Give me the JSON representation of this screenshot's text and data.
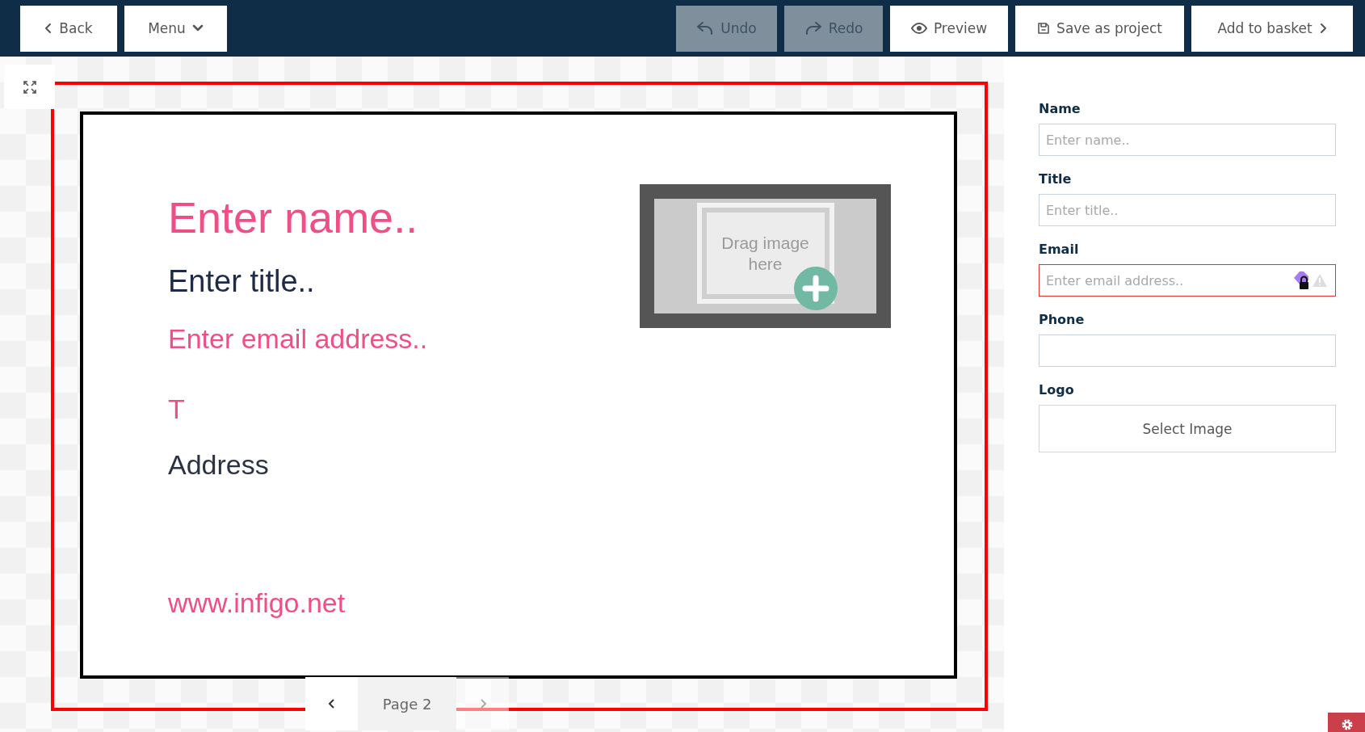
{
  "toolbar": {
    "left": [
      {
        "kind": "back",
        "label": "Back",
        "disabled": false
      },
      {
        "kind": "menu",
        "label": "Menu",
        "disabled": false
      }
    ],
    "right": [
      {
        "kind": "undo",
        "label": "Undo",
        "disabled": true
      },
      {
        "kind": "redo",
        "label": "Redo",
        "disabled": true
      },
      {
        "kind": "preview",
        "label": "Preview",
        "disabled": false
      },
      {
        "kind": "save",
        "label": "Save as project",
        "disabled": false
      },
      {
        "kind": "basket",
        "label": "Add to basket",
        "disabled": false
      }
    ]
  },
  "card": {
    "items": [
      {
        "kind": "name",
        "text": "Enter name.."
      },
      {
        "kind": "title",
        "text": "Enter title.."
      },
      {
        "kind": "email",
        "text": "Enter email address.."
      },
      {
        "kind": "phone",
        "text": "T"
      },
      {
        "kind": "address",
        "text": "Address"
      },
      {
        "kind": "website",
        "text": "www.infigo.net"
      }
    ],
    "image_placeholder": {
      "text": "Drag image here"
    }
  },
  "pager": {
    "label": "Page 2",
    "prev_disabled": false,
    "next_disabled": true
  },
  "form": {
    "fields": [
      {
        "label": "Name",
        "placeholder": "Enter name..",
        "invalid": false
      },
      {
        "label": "Title",
        "placeholder": "Enter title..",
        "invalid": false
      },
      {
        "label": "Email",
        "placeholder": "Enter email address..",
        "invalid": true
      },
      {
        "label": "Phone",
        "invalid": false
      }
    ],
    "logo": {
      "label": "Logo",
      "button": "Select Image"
    }
  }
}
